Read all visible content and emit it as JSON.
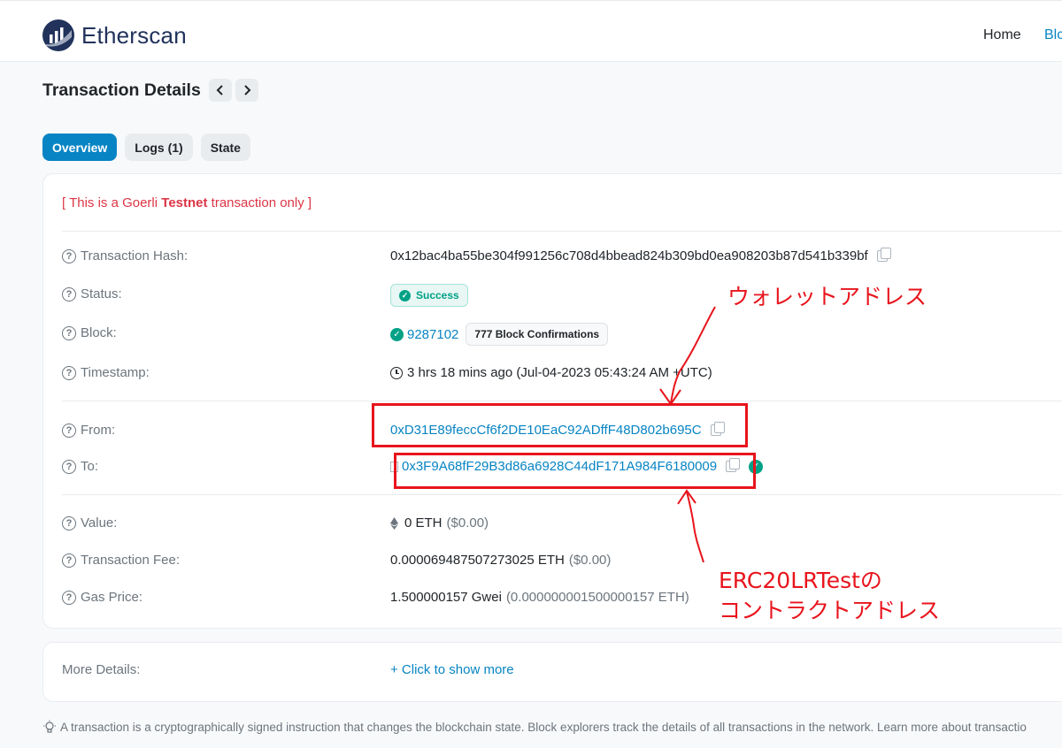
{
  "header": {
    "logo_text": "Etherscan",
    "nav_home": "Home",
    "nav_blockchain_partial": "Blc"
  },
  "page": {
    "title": "Transaction Details",
    "prev_label": "‹",
    "next_label": "›"
  },
  "tabs": [
    {
      "label": "Overview",
      "active": true
    },
    {
      "label": "Logs (1)",
      "active": false
    },
    {
      "label": "State",
      "active": false
    }
  ],
  "notice": {
    "prefix": "[ This is a Goerli ",
    "bold": "Testnet",
    "suffix": " transaction only ]"
  },
  "details": {
    "tx_hash_label": "Transaction Hash:",
    "tx_hash": "0x12bac4ba55be304f991256c708d4bbead824b309bd0ea908203b87d541b339bf",
    "status_label": "Status:",
    "status": "Success",
    "block_label": "Block:",
    "block_number": "9287102",
    "block_confirmations": "777 Block Confirmations",
    "timestamp_label": "Timestamp:",
    "timestamp": "3 hrs 18 mins ago (Jul-04-2023 05:43:24 AM +UTC)",
    "from_label": "From:",
    "from_address": "0xD31E89feccCf6f2DE10EaC92ADffF48D802b695C",
    "to_label": "To:",
    "to_address": "0x3F9A68fF29B3d86a6928C44dF171A984F6180009",
    "value_label": "Value:",
    "value_eth": "0 ETH",
    "value_usd": "($0.00)",
    "fee_label": "Transaction Fee:",
    "fee_eth": "0.000069487507273025 ETH",
    "fee_usd": "($0.00)",
    "gas_label": "Gas Price:",
    "gas_gwei": "1.500000157 Gwei",
    "gas_eth": "(0.000000001500000157 ETH)"
  },
  "more": {
    "label": "More Details:",
    "link": "+ Click to show more"
  },
  "footer_note": "A transaction is a cryptographically signed instruction that changes the blockchain state. Block explorers track the details of all transactions in the network. Learn more about transactio",
  "annotations": {
    "wallet": "ウォレットアドレス",
    "contract_line1": "ERC20LRTestの",
    "contract_line2": "コントラクトアドレス"
  },
  "colors": {
    "accent": "#0784c3",
    "success": "#00a186",
    "annotation": "#e8141c",
    "testnet_text": "#dc3545"
  }
}
